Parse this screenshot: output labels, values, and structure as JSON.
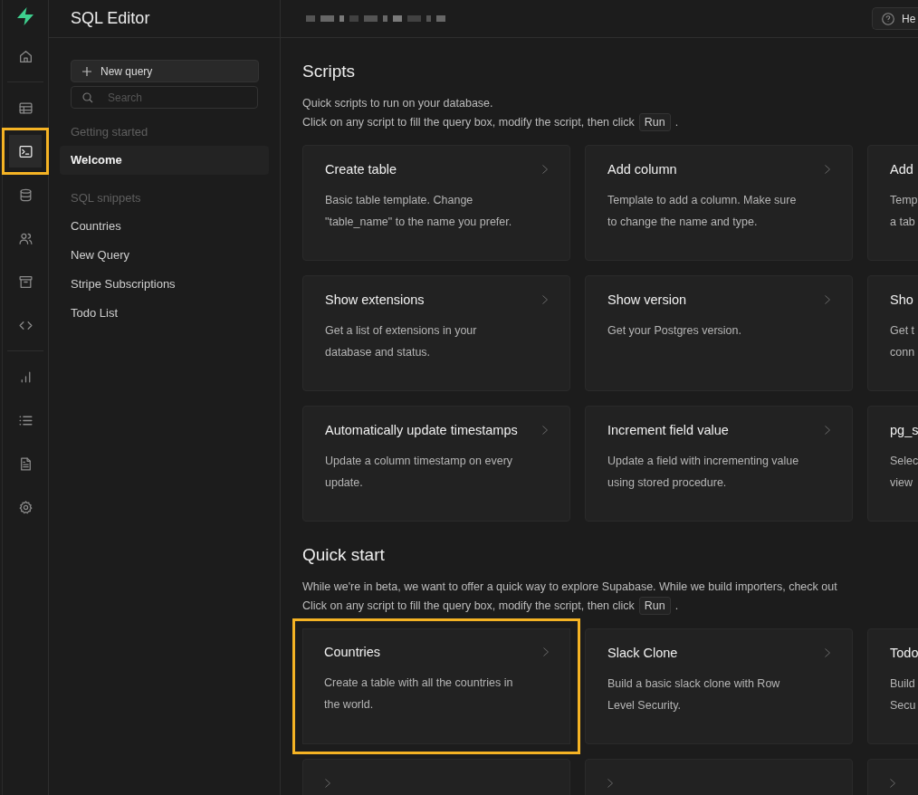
{
  "rail": {
    "groups": [
      [
        {
          "selected": false,
          "highlighted": false
        }
      ],
      [
        {
          "selected": false,
          "highlighted": false
        },
        {
          "selected": true,
          "highlighted": true
        },
        {
          "selected": false,
          "highlighted": false
        },
        {
          "selected": false,
          "highlighted": false
        },
        {
          "selected": false,
          "highlighted": false
        },
        {
          "selected": false,
          "highlighted": false
        }
      ],
      [
        {
          "selected": false,
          "highlighted": false
        },
        {
          "selected": false,
          "highlighted": false
        },
        {
          "selected": false,
          "highlighted": false
        },
        {
          "selected": false,
          "highlighted": false
        }
      ]
    ]
  },
  "sidebar": {
    "title": "SQL Editor",
    "new_query": "New query",
    "search": {
      "placeholder": "Search"
    },
    "sections": [
      {
        "heading": "Getting started",
        "items": [
          {
            "label": "Welcome",
            "selected": true
          }
        ]
      },
      {
        "heading": "SQL snippets",
        "items": [
          {
            "label": "Countries",
            "selected": false
          },
          {
            "label": "New Query",
            "selected": false
          },
          {
            "label": "Stripe Subscriptions",
            "selected": false
          },
          {
            "label": "Todo List",
            "selected": false
          }
        ]
      }
    ]
  },
  "header": {
    "help_button": "He"
  },
  "sections": [
    {
      "title": "Scripts",
      "intro": [
        "Quick scripts to run on your database."
      ],
      "hint": {
        "before": "Click on any script to fill the query box, modify the script, then click",
        "code": "Run",
        "after": "."
      },
      "rows": [
        [
          {
            "title": "Create table",
            "lines": [
              "Basic table template. Change",
              "\"table_name\" to the name you prefer."
            ],
            "highlighted": false
          },
          {
            "title": "Add column",
            "lines": [
              "Template to add a column. Make sure",
              "to change the name and type."
            ],
            "highlighted": false
          },
          {
            "title": "Add",
            "lines": [
              "Temp",
              "a tab"
            ],
            "highlighted": false
          }
        ],
        [
          {
            "title": "Show extensions",
            "lines": [
              "Get a list of extensions in your",
              "database and status."
            ],
            "highlighted": false
          },
          {
            "title": "Show version",
            "lines": [
              "Get your Postgres version."
            ],
            "highlighted": false
          },
          {
            "title": "Sho",
            "lines": [
              "Get t",
              "conn"
            ],
            "highlighted": false
          }
        ],
        [
          {
            "title": "Automatically update timestamps",
            "lines": [
              "Update a column timestamp on every",
              "update."
            ],
            "highlighted": false
          },
          {
            "title": "Increment field value",
            "lines": [
              "Update a field with incrementing value",
              "using stored procedure."
            ],
            "highlighted": false
          },
          {
            "title": "pg_s",
            "lines": [
              "Selec",
              "view"
            ],
            "highlighted": false
          }
        ]
      ]
    },
    {
      "title": "Quick start",
      "intro": [
        "While we're in beta, we want to offer a quick way to explore Supabase. While we build importers, check out"
      ],
      "hint": {
        "before": "Click on any script to fill the query box, modify the script, then click",
        "code": "Run",
        "after": "."
      },
      "rows": [
        [
          {
            "title": "Countries",
            "lines": [
              "Create a table with all the countries in",
              "the world."
            ],
            "highlighted": true
          },
          {
            "title": "Slack Clone",
            "lines": [
              "Build a basic slack clone with Row",
              "Level Security."
            ],
            "highlighted": false
          },
          {
            "title": "Todo",
            "lines": [
              "Build",
              "Secu"
            ],
            "highlighted": false
          }
        ],
        [
          {
            "highlighted": false
          },
          {
            "highlighted": false
          },
          {
            "highlighted": false
          }
        ]
      ]
    }
  ]
}
